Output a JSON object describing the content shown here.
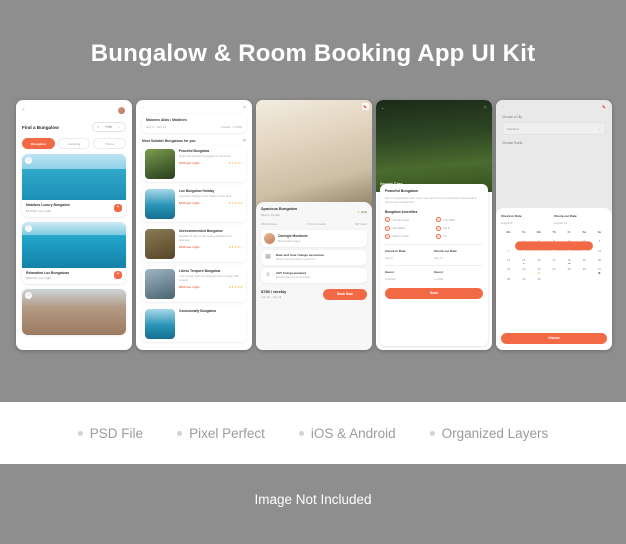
{
  "hero": {
    "title": "Bungalow & Room Booking App UI Kit"
  },
  "footer": {
    "features": [
      "PSD File",
      "Pixel Perfect",
      "iOS & Android",
      "Organized Layers"
    ],
    "note": "Image Not Included"
  },
  "colors": {
    "accent": "#f26a45",
    "background": "#8e8e8e",
    "band": "#ffffff",
    "star": "#f6b93b"
  },
  "screens": {
    "home": {
      "menu_icon": "hamburger-icon",
      "avatar": "user-avatar",
      "title": "Find a Bungalow",
      "filter_label": "Filter",
      "tabs": [
        "Bungalow",
        "Camping",
        "Home"
      ],
      "active_tab": "Bungalow",
      "cards": [
        {
          "title": "Maldives Luxury Bungalow",
          "price": "$470.00 / per night",
          "action": "+"
        },
        {
          "title": "Relaxation Lux Bungalows",
          "price": "$520.00 / per night",
          "action": "+"
        }
      ]
    },
    "search": {
      "back_icon": "back-arrow-icon",
      "settings_icon": "settings-icon",
      "location": "Malones Alias / Maldives",
      "dates": "July 9 - July 13",
      "guests": "2 Adult - 1 Child",
      "section_title": "Most Suitable Bungalows for you",
      "list_icon": "list-view-icon",
      "items": [
        {
          "title": "Peaceful Bungalow",
          "desc": "Quiet and peaceful bungalow in the forest",
          "price": "$150 /per night",
          "stars": "★★★★☆"
        },
        {
          "title": "Lux Bungalow Holiday",
          "desc": "Luxurious holiday in the middle of the blue",
          "price": "$240 /per night",
          "stars": "★★★★★"
        },
        {
          "title": "Unrecommended Bungalow",
          "desc": "Detailes of duty or the peace obligations of business",
          "price": "$160 /per night",
          "stars": "★★★★☆"
        },
        {
          "title": "Libero Tempore Bungalow",
          "desc": "Cum soluta nobis est eligendi optio cumque nihil impedit",
          "price": "$200 /per night",
          "stars": "★★★★★"
        },
        {
          "title": "Occasionally Bungalow",
          "desc": "",
          "price": "",
          "stars": ""
        }
      ]
    },
    "detail": {
      "bookmark_icon": "bookmark-icon",
      "title": "Spacious Bungalow",
      "location": "Miami, Florida",
      "rating": "(4.9)",
      "stats": [
        "250 Reviews",
        "1.7k Comments",
        "467 Likes"
      ],
      "agent": {
        "name": "Carnegie Mondover",
        "role": "Real Estate Agent"
      },
      "features": [
        {
          "icon": "calendar-edit-icon",
          "title": "Date and time change assurance",
          "desc": "Maxime placeat facere possimus"
        },
        {
          "icon": "phone-icon",
          "title": "24/7 Call guaranteed",
          "desc": "Epudiandae sint et molestiae"
        }
      ],
      "price": "$780 / weekly",
      "price_dates": "July 12 - July 19",
      "book_label": "Book Now"
    },
    "amenities": {
      "back_icon": "back-arrow-icon",
      "heart_icon": "heart-icon",
      "overlay_logo": "Georgia Tulsa",
      "title": "Peaceful Bungalow",
      "desc": "Sed ut perspiciatis unde omnis iste natus error sit voluptatem accusantium doloremque laudantium.",
      "section_title": "Bungalow Amenities",
      "items": [
        "Tennis Court",
        "Car Park",
        "Hot Water",
        "Wi-Fi",
        "Money Case",
        "Tv"
      ],
      "checkin_label": "Check-in Date",
      "checkin_value": "July 9",
      "checkout_label": "Check-out Date",
      "checkout_value": "July 17",
      "guest_label_1": "Guest",
      "guest_value_1": "2 Adults",
      "guest_label_2": "Guest",
      "guest_value_2": "1 Child",
      "book_label": "Book"
    },
    "calendar": {
      "back_icon": "back-arrow-icon",
      "bookmark_icon": "bookmark-icon",
      "city_label": "Choose a City",
      "city_value": "Maldives",
      "guest_label": "Choose Guest",
      "checkin_label": "Check-in Date",
      "checkin_value": "August 8",
      "checkout_label": "Check-out Date",
      "checkout_value": "August 12",
      "dow": [
        "Mo",
        "Tu",
        "We",
        "Th",
        "Fr",
        "Sa",
        "Su"
      ],
      "days": [
        "",
        "1",
        "2",
        "3",
        "4",
        "5",
        "6",
        "7",
        "8",
        "9",
        "10",
        "11",
        "12",
        "13",
        "14",
        "15",
        "16",
        "17",
        "18",
        "19",
        "20",
        "21",
        "22",
        "23",
        "24",
        "25",
        "26",
        "27",
        "28",
        "29",
        "30",
        "",
        "",
        "",
        ""
      ],
      "selected": [
        "8",
        "9",
        "10",
        "11",
        "12"
      ],
      "choose_label": "Choose"
    }
  }
}
